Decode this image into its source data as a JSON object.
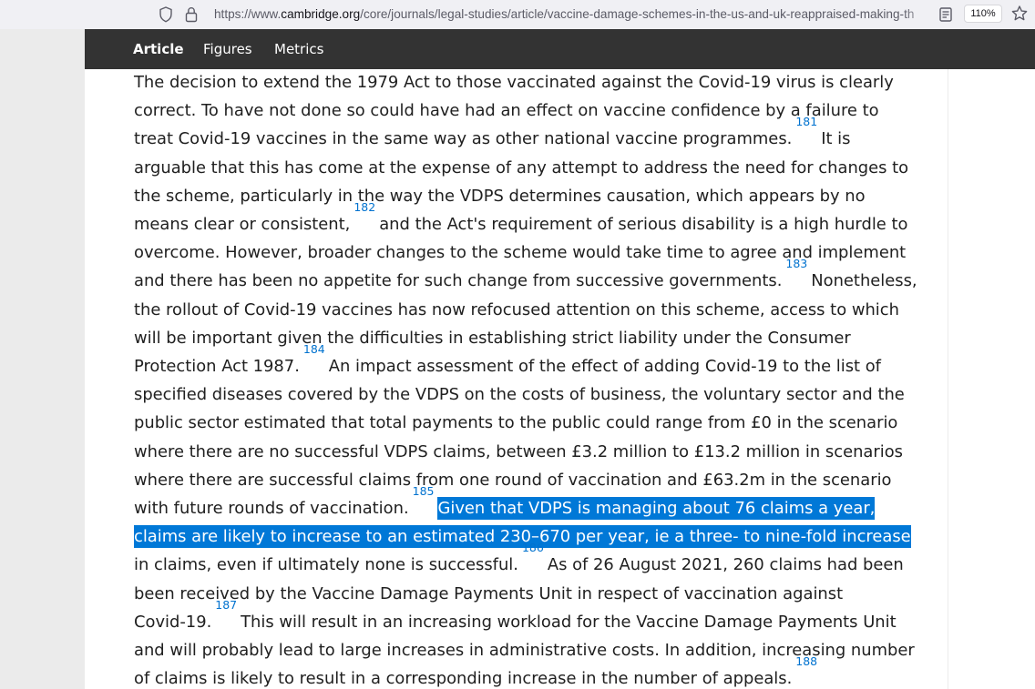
{
  "browser": {
    "url_prefix": "https://www.",
    "url_host": "cambridge.org",
    "url_path": "/core/journals/legal-studies/article/vaccine-damage-schemes-in-the-us-and-uk-reappraised-making-th",
    "zoom_level": "110%",
    "icons": [
      "shield-icon",
      "lock-icon",
      "reader-view-icon",
      "bookmark-star-icon"
    ]
  },
  "tabs": [
    {
      "label": "Article",
      "active": true
    },
    {
      "label": "Figures",
      "active": false
    },
    {
      "label": "Metrics",
      "active": false
    }
  ],
  "colors": {
    "tab_bar": "#333333",
    "footnote_link": "#0072cf",
    "selection_highlight": "#0078d7"
  },
  "paragraph": {
    "l01": "The decision to extend the 1979 Act to those vaccinated against the Covid-19 virus is clearly",
    "l02": "correct. To have not done so could have had an effect on vaccine confidence by a failure to",
    "l03a": "treat Covid-19 vaccines in the same way as other national vaccine programmes.",
    "fn181": "181",
    "l03b": "It is",
    "l04": "arguable that this has come at the expense of any attempt to address the need for changes to",
    "l05": "the scheme, particularly in the way the VDPS determines causation, which appears by no",
    "l06a": "means clear or consistent,",
    "fn182": "182",
    "l06b": "and the Act's requirement of serious disability is a high hurdle to",
    "l07": "overcome. However, broader changes to the scheme would take time to agree and implement",
    "l08a": "and there has been no appetite for such change from successive governments.",
    "fn183": "183",
    "l08b": "Nonetheless,",
    "l09": "the rollout of Covid-19 vaccines has now refocused attention on this scheme, access to which",
    "l10": "will be important given the difficulties in establishing strict liability under the Consumer",
    "l11a": "Protection Act 1987.",
    "fn184": "184",
    "l11b": "An impact assessment of the effect of adding Covid-19 to the list of",
    "l12": "specified diseases covered by the VDPS on the costs of business, the voluntary sector and the",
    "l13": "public sector estimated that total payments to the public could range from £0 in the scenario",
    "l14": "where there are no successful VDPS claims, between £3.2 million to £13.2 million in scenarios",
    "l15": "where there are successful claims from one round of vaccination and £63.2m in the scenario",
    "l16a": "with future rounds of vaccination.",
    "fn185": "185",
    "l16b": "Given that VDPS is managing about 76 claims a year,",
    "l17": "claims are likely to increase to an estimated 230–670 per year, ie a three- to nine-fold increase",
    "l18a": "in claims, even if ultimately none is successful.",
    "fn186": "186",
    "l18b": "As of 26 August 2021, 260 claims had been",
    "l19": "been received by the Vaccine Damage Payments Unit in respect of vaccination against",
    "l20a": "Covid-19.",
    "fn187": "187",
    "l20b": "This will result in an increasing workload for the Vaccine Damage Payments Unit",
    "l21": "and will probably lead to large increases in administrative costs. In addition, increasing number",
    "l22a": "of claims is likely to result in a corresponding increase in the number of appeals.",
    "fn188": "188"
  }
}
